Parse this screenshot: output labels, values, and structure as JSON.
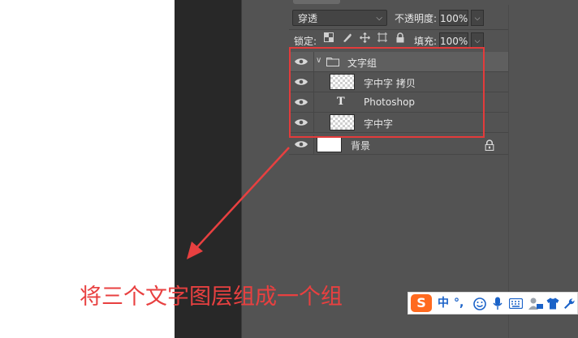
{
  "layers_panel": {
    "blend_mode": "穿透",
    "opacity_label": "不透明度:",
    "opacity_value": "100%",
    "lock_label": "锁定:",
    "fill_label": "填充:",
    "fill_value": "100%",
    "layers": [
      {
        "name": "文字组",
        "kind": "group"
      },
      {
        "name": "字中字 拷贝",
        "kind": "pixel"
      },
      {
        "name": "Photoshop",
        "kind": "text",
        "type_glyph": "T"
      },
      {
        "name": "字中字",
        "kind": "pixel"
      },
      {
        "name": "背景",
        "kind": "background",
        "locked": true
      }
    ]
  },
  "annotation": {
    "caption": "将三个文字图层组成一个组",
    "highlight_color": "#e33b3b"
  },
  "ime_toolbar": {
    "logo": "S",
    "lang": "中",
    "punct": "°,",
    "icons": [
      "emoji-icon",
      "mic-icon",
      "keyboard-icon",
      "skin-user-icon",
      "shirt-icon",
      "wrench-icon"
    ]
  }
}
